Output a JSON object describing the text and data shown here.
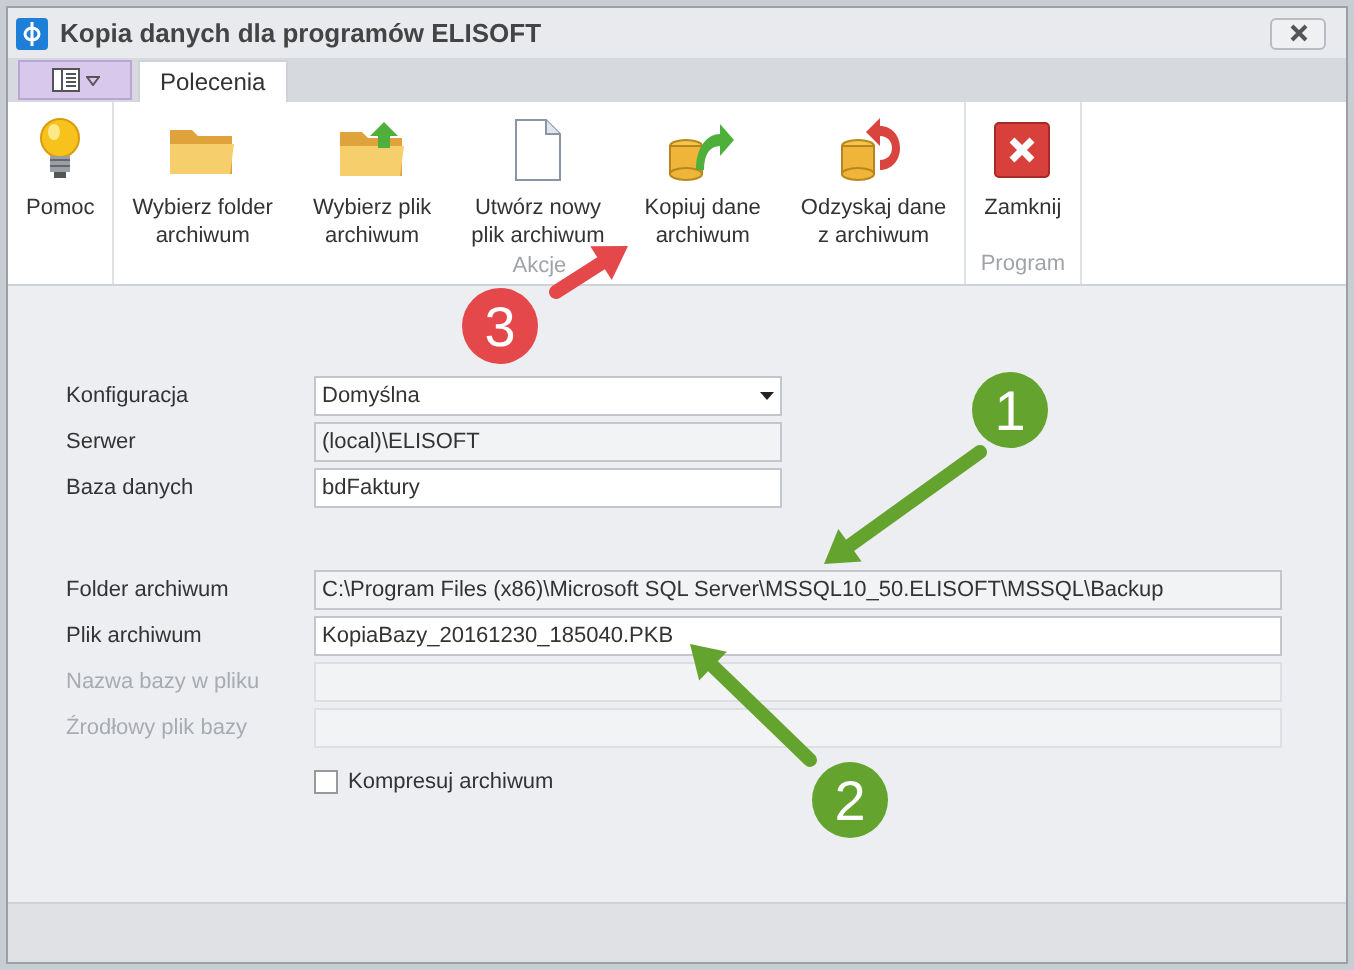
{
  "window": {
    "title": "Kopia danych dla programów ELISOFT"
  },
  "tabs": [
    {
      "label": "Polecenia",
      "selected": true
    }
  ],
  "ribbon": [
    {
      "buttons": [
        {
          "kind": "bulb",
          "lines": [
            "Pomoc"
          ]
        }
      ]
    },
    {
      "label": "Akcje",
      "buttons": [
        {
          "kind": "folder",
          "lines": [
            "Wybierz folder",
            "archiwum"
          ]
        },
        {
          "kind": "folder-up",
          "lines": [
            "Wybierz plik",
            "archiwum"
          ]
        },
        {
          "kind": "document",
          "lines": [
            "Utwórz nowy",
            "plik archiwum"
          ]
        },
        {
          "kind": "db-export",
          "lines": [
            "Kopiuj dane",
            "archiwum"
          ]
        },
        {
          "kind": "db-import",
          "lines": [
            "Odzyskaj dane",
            "z archiwum"
          ]
        }
      ]
    },
    {
      "label": "Program",
      "buttons": [
        {
          "kind": "close",
          "lines": [
            "Zamknij"
          ]
        }
      ]
    }
  ],
  "form": {
    "sections": [
      {
        "fields": [
          {
            "label": "Konfiguracja",
            "value": "Domyślna",
            "kind": "dropdown",
            "disabled": false,
            "readonly": false
          },
          {
            "label": "Serwer",
            "value": "(local)\\ELISOFT",
            "kind": "text",
            "disabled": false,
            "readonly": true
          },
          {
            "label": "Baza danych",
            "value": "bdFaktury",
            "kind": "text",
            "disabled": false,
            "readonly": false
          }
        ]
      },
      {
        "fields": [
          {
            "label": "Folder archiwum",
            "value": "C:\\Program Files (x86)\\Microsoft SQL Server\\MSSQL10_50.ELISOFT\\MSSQL\\Backup",
            "kind": "text",
            "disabled": false,
            "readonly": true
          },
          {
            "label": "Plik archiwum",
            "value": "KopiaBazy_20161230_185040.PKB",
            "kind": "text",
            "disabled": false,
            "readonly": false
          },
          {
            "label": "Nazwa bazy w pliku",
            "kind": "text",
            "disabled": true,
            "readonly": true
          },
          {
            "label": "Źrodłowy plik bazy",
            "kind": "text",
            "disabled": true,
            "readonly": true
          }
        ]
      }
    ],
    "checkbox": {
      "label": "Kompresuj archiwum",
      "checked": false
    }
  },
  "annotations": [
    {
      "number": "3",
      "color": "#e4484a"
    },
    {
      "number": "1",
      "color": "#65a32f"
    },
    {
      "number": "2",
      "color": "#65a32f"
    }
  ]
}
